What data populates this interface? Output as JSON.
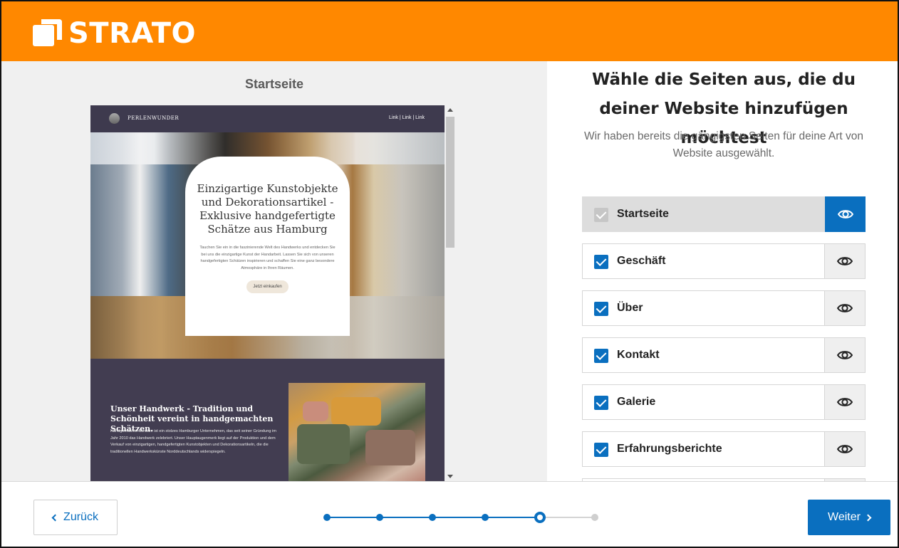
{
  "brand": {
    "name": "STRATO",
    "color": "#ff8800"
  },
  "preview": {
    "label": "Startseite",
    "site": {
      "brand": "PERLENWUNDER",
      "nav_links": "Link | Link | Link",
      "hero_title": "Einzigartige Kunstobjekte und Dekorationsartikel - Exklusive handgefertigte Schätze aus Hamburg",
      "hero_text": "Tauchen Sie ein in die faszinierende Welt des Handwerks und entdecken Sie bei uns die einzigartige Kunst der Handarbeit. Lassen Sie sich von unseren handgefertigten Schätzen inspirieren und schaffen Sie eine ganz besondere Atmosphäre in Ihren Räumen.",
      "hero_button": "Jetzt einkaufen",
      "section_title": "Unser Handwerk - Tradition und Schönheit vereint in handgemachten Schätzen.",
      "section_text": "Handgemachte Schätze ist ein stolzes Hamburger Unternehmen, das seit seiner Gründung im Jahr 2010 das Handwerk zelebriert. Unser Hauptaugenmerk liegt auf der Produktion und dem Verkauf von einzigartigen, handgefertigten Kunstobjekten und Dekorationsartikeln, die die traditionellen Handwerkskünste Norddeutschlands widerspiegeln."
    }
  },
  "selection": {
    "heading": "Wähle die Seiten aus, die du deiner Website hinzufügen möchtest",
    "subheading": "Wir haben bereits die gängigsten Seiten für deine Art von Website ausgewählt.",
    "pages": [
      {
        "label": "Startseite",
        "checked": true,
        "disabled": true,
        "previewing": true
      },
      {
        "label": "Geschäft",
        "checked": true,
        "disabled": false,
        "previewing": false
      },
      {
        "label": "Über",
        "checked": true,
        "disabled": false,
        "previewing": false
      },
      {
        "label": "Kontakt",
        "checked": true,
        "disabled": false,
        "previewing": false
      },
      {
        "label": "Galerie",
        "checked": true,
        "disabled": false,
        "previewing": false
      },
      {
        "label": "Erfahrungsberichte",
        "checked": true,
        "disabled": false,
        "previewing": false
      }
    ]
  },
  "footer": {
    "back_label": "Zurück",
    "next_label": "Weiter",
    "steps_total": 6,
    "current_step": 5
  },
  "colors": {
    "accent": "#0a6fbf",
    "brand_orange": "#ff8800"
  }
}
